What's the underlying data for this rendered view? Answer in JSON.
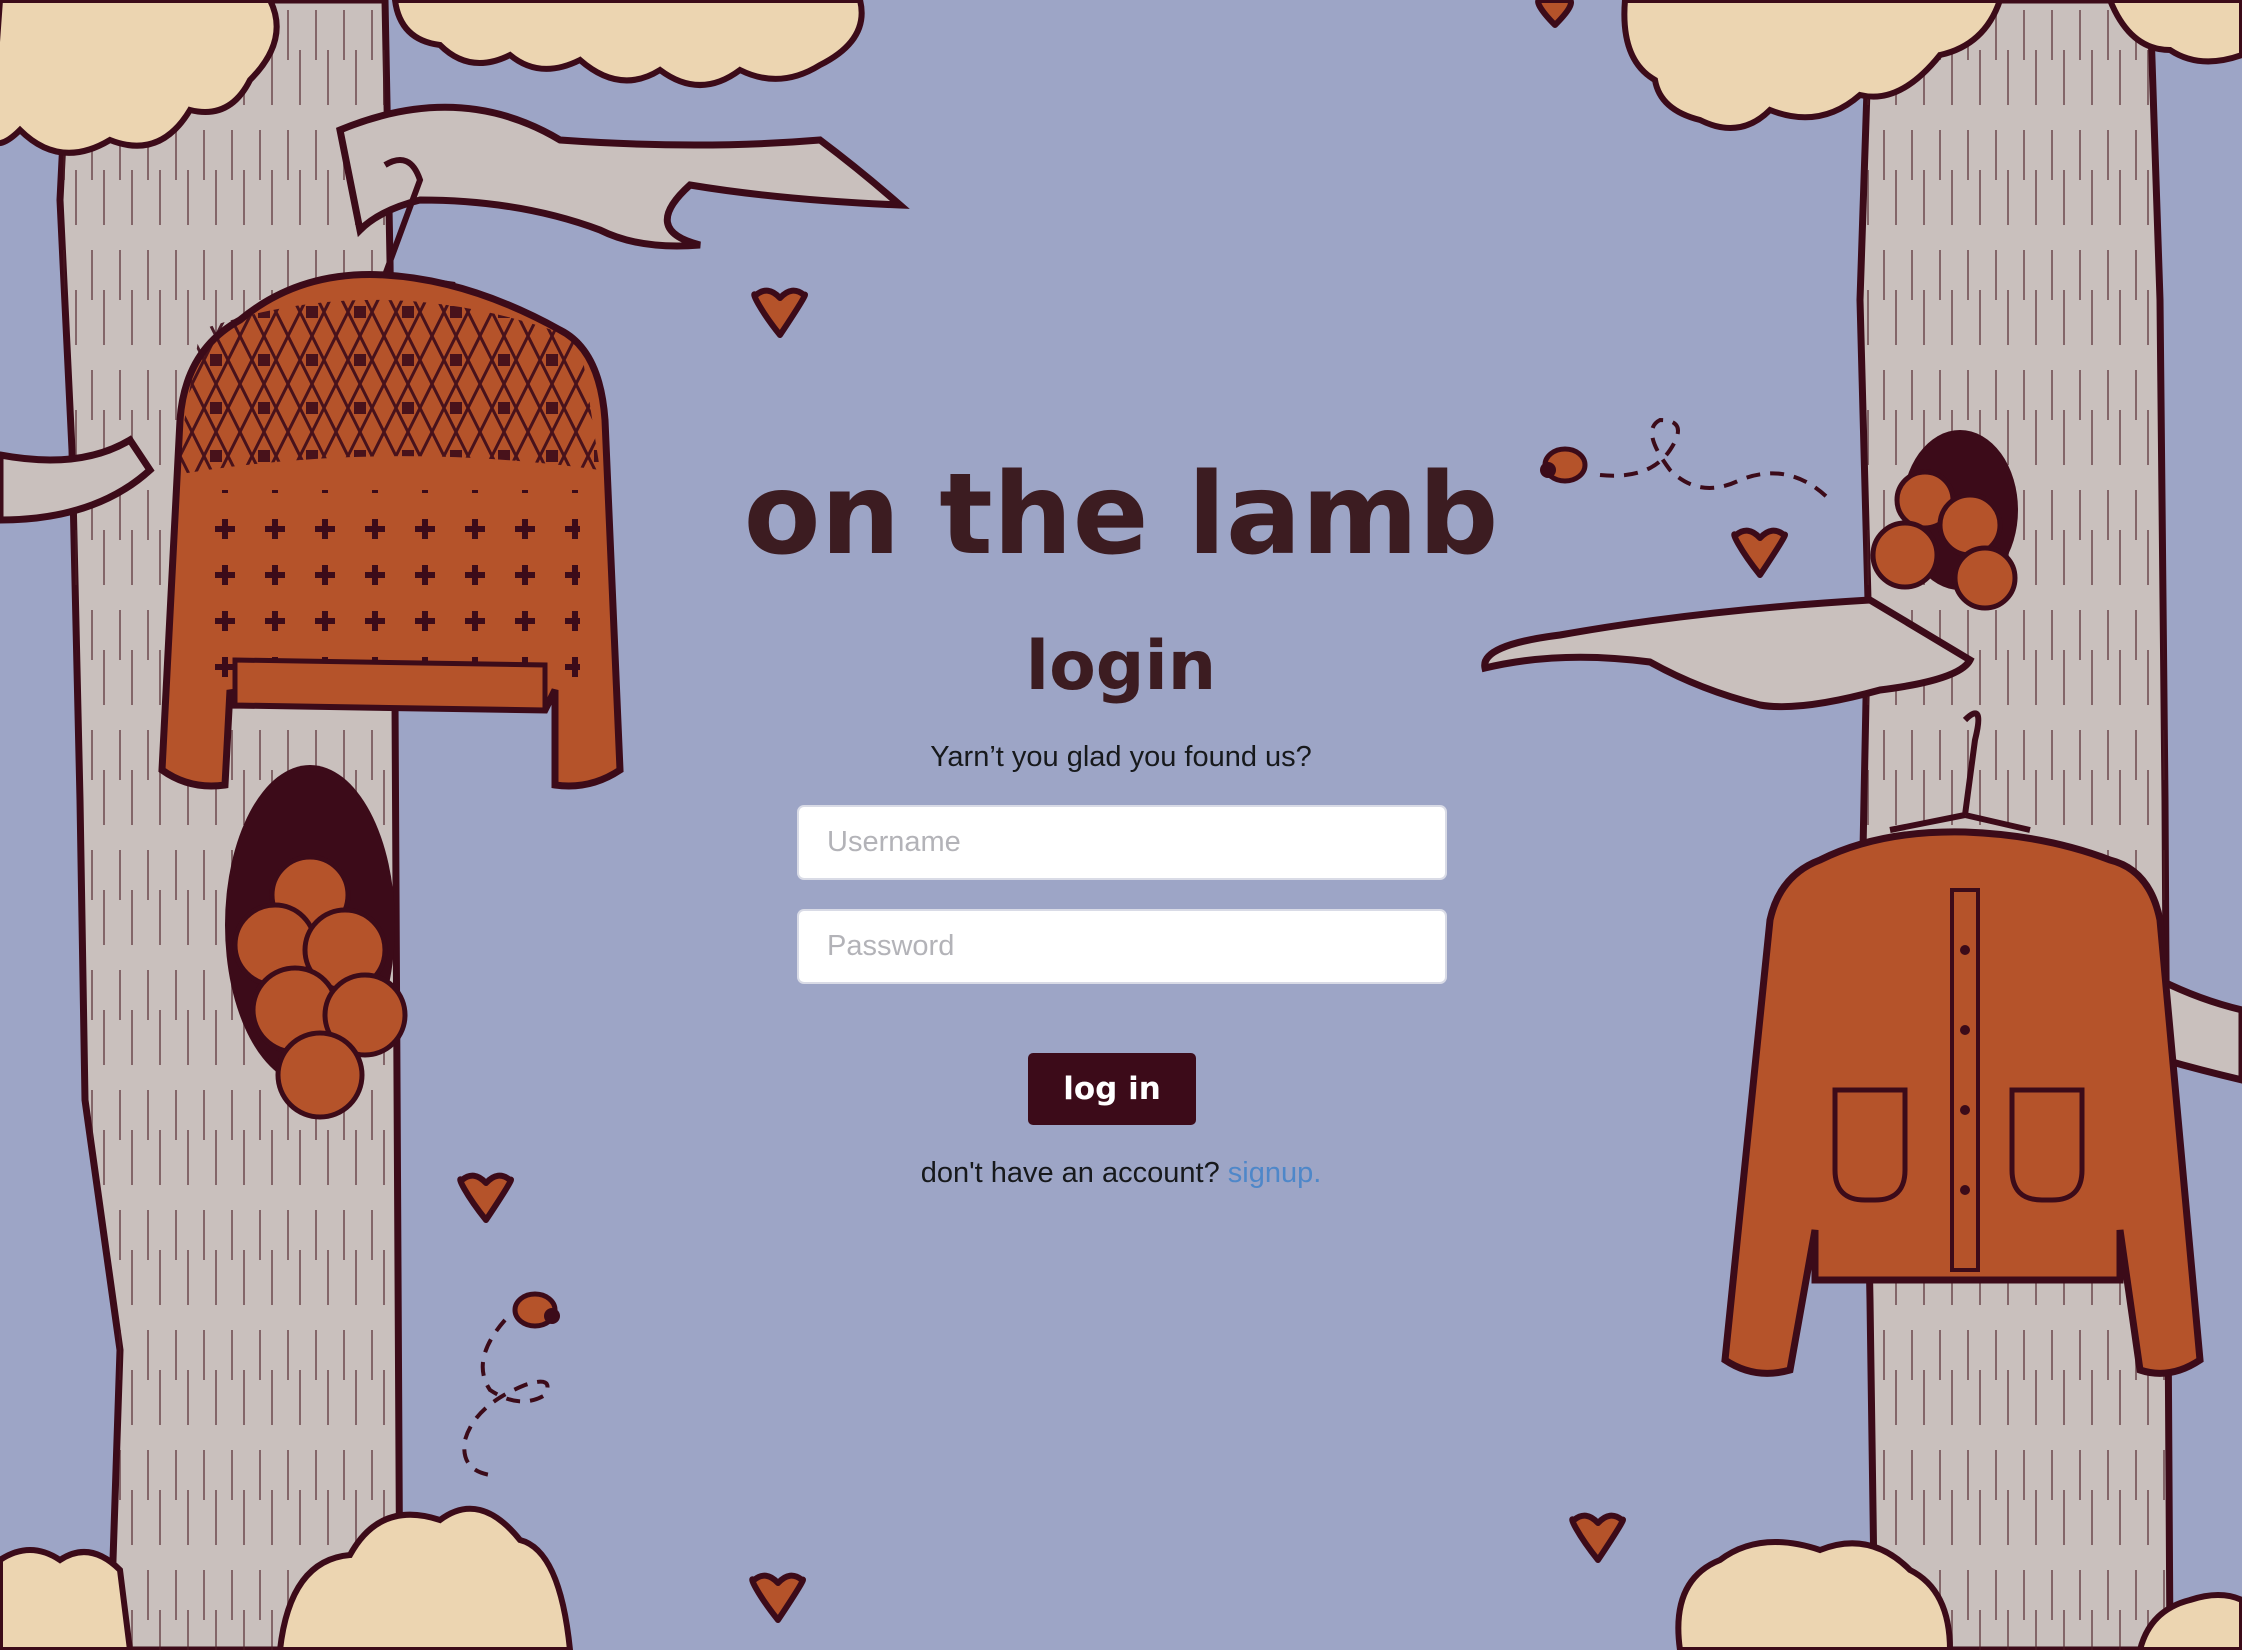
{
  "brand": {
    "title": "on the lamb"
  },
  "login": {
    "heading": "login",
    "tagline": "Yarn’t you glad you found us?",
    "username_placeholder": "Username",
    "password_placeholder": "Password",
    "submit_label": "log in",
    "signup_prompt": "don't have an account?",
    "signup_link": "signup."
  },
  "colors": {
    "background": "#9da5c6",
    "brand_text": "#3c1c21",
    "button_bg": "#3c0b19",
    "link": "#4e87c9",
    "sweater": "#b5532a",
    "trunk": "#c9c0bd",
    "foliage": "#ecd5b1"
  },
  "illustration": {
    "icons": [
      "tree-trunk-icon",
      "fair-isle-sweater-icon",
      "cardigan-icon",
      "yarn-ball-icon",
      "heart-icon",
      "bee-icon",
      "cloud-foliage-icon",
      "hanger-icon"
    ]
  }
}
